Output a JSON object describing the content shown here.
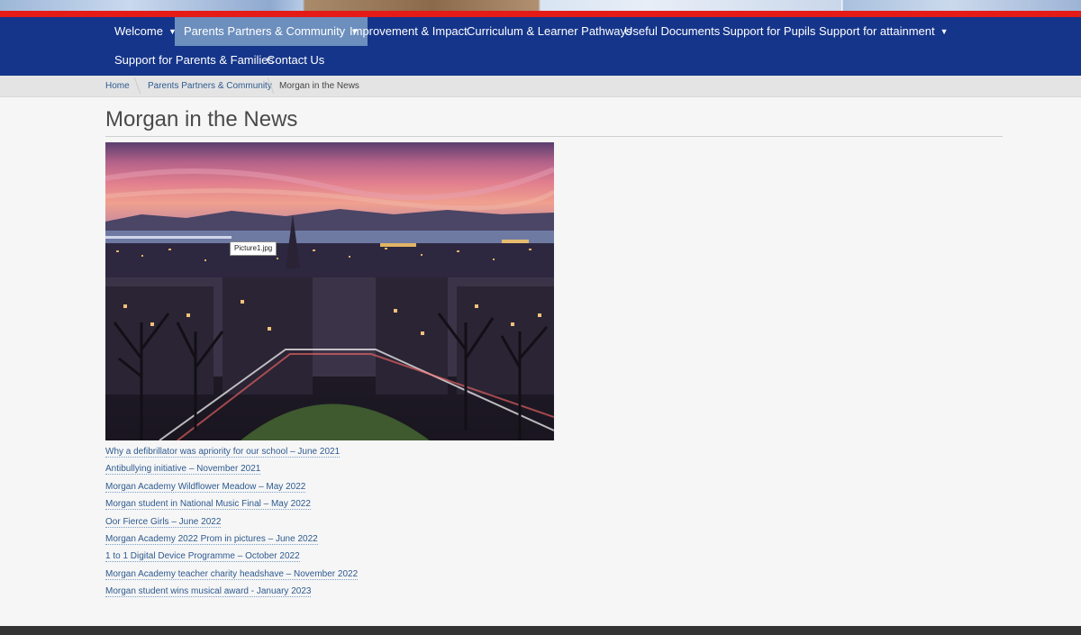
{
  "nav": {
    "items": [
      {
        "label": "Welcome",
        "has_dropdown": true,
        "active": false
      },
      {
        "label": "Parents Partners & Community",
        "has_dropdown": true,
        "active": true
      },
      {
        "label": "Improvement & Impact",
        "has_dropdown": false,
        "active": false
      },
      {
        "label": "Curriculum & Learner Pathways",
        "has_dropdown": false,
        "active": false
      },
      {
        "label": "Useful Documents",
        "has_dropdown": false,
        "active": false
      },
      {
        "label": "Support for Pupils",
        "has_dropdown": false,
        "active": false
      },
      {
        "label": "Support for attainment",
        "has_dropdown": true,
        "active": false
      },
      {
        "label": "Support for Parents & Families",
        "has_dropdown": false,
        "active": false
      },
      {
        "label": "Contact Us",
        "has_dropdown": false,
        "active": false
      }
    ],
    "caret": "▼"
  },
  "breadcrumb": {
    "home": "Home",
    "section": "Parents Partners & Community",
    "current": "Morgan in the News"
  },
  "page": {
    "title": "Morgan in the News",
    "image_tooltip": "Picture1.jpg"
  },
  "news_links": [
    "Why a defibrillator was apriority for our school – June 2021",
    "Antibullying initiative – November 2021",
    "Morgan Academy Wildflower Meadow – May 2022",
    "Morgan student in National Music Final – May 2022",
    "Oor Fierce Girls – June 2022",
    "Morgan Academy 2022 Prom in pictures – June 2022",
    "1 to 1 Digital Device Programme – October 2022",
    "Morgan Academy teacher charity headshave – November 2022",
    "Morgan student wins musical award  - January 2023"
  ],
  "colors": {
    "nav_bg": "#15358a",
    "nav_active": "#6c8fbe",
    "accent_red": "#e41b17",
    "link": "#2d5a8f"
  }
}
